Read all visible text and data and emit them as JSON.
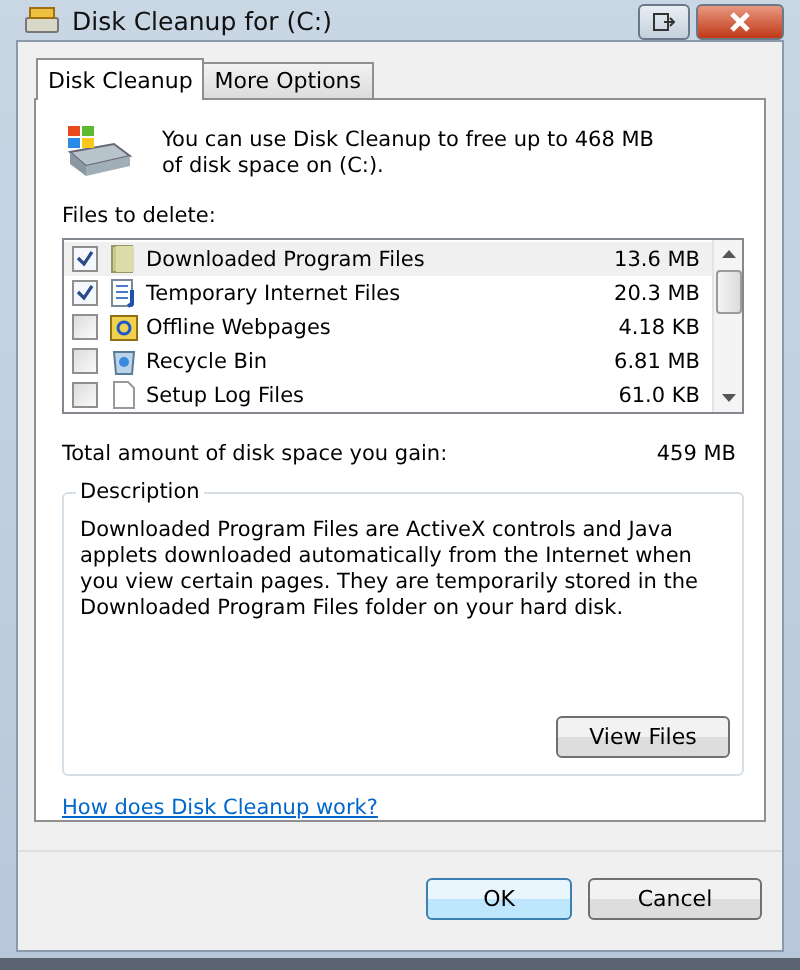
{
  "window": {
    "title": "Disk Cleanup for  (C:)"
  },
  "tabs": [
    {
      "label": "Disk Cleanup",
      "selected": true
    },
    {
      "label": "More Options",
      "selected": false
    }
  ],
  "intro": "You can use Disk Cleanup to free up to 468 MB of disk space on  (C:).",
  "files_label": "Files to delete:",
  "files": [
    {
      "name": "Downloaded Program Files",
      "size": "13.6 MB",
      "checked": true,
      "selected": true
    },
    {
      "name": "Temporary Internet Files",
      "size": "20.3 MB",
      "checked": true,
      "selected": false
    },
    {
      "name": "Offline Webpages",
      "size": "4.18 KB",
      "checked": false,
      "selected": false
    },
    {
      "name": "Recycle Bin",
      "size": "6.81 MB",
      "checked": false,
      "selected": false
    },
    {
      "name": "Setup Log Files",
      "size": "61.0 KB",
      "checked": false,
      "selected": false
    }
  ],
  "total": {
    "label": "Total amount of disk space you gain:",
    "value": "459 MB"
  },
  "description": {
    "title": "Description",
    "text": "Downloaded Program Files are ActiveX controls and Java applets downloaded automatically from the Internet when you view certain pages. They are temporarily stored in the Downloaded Program Files folder on your hard disk.",
    "button": "View Files"
  },
  "help_link": "How does Disk Cleanup work?",
  "buttons": [
    "OK",
    "Cancel"
  ]
}
